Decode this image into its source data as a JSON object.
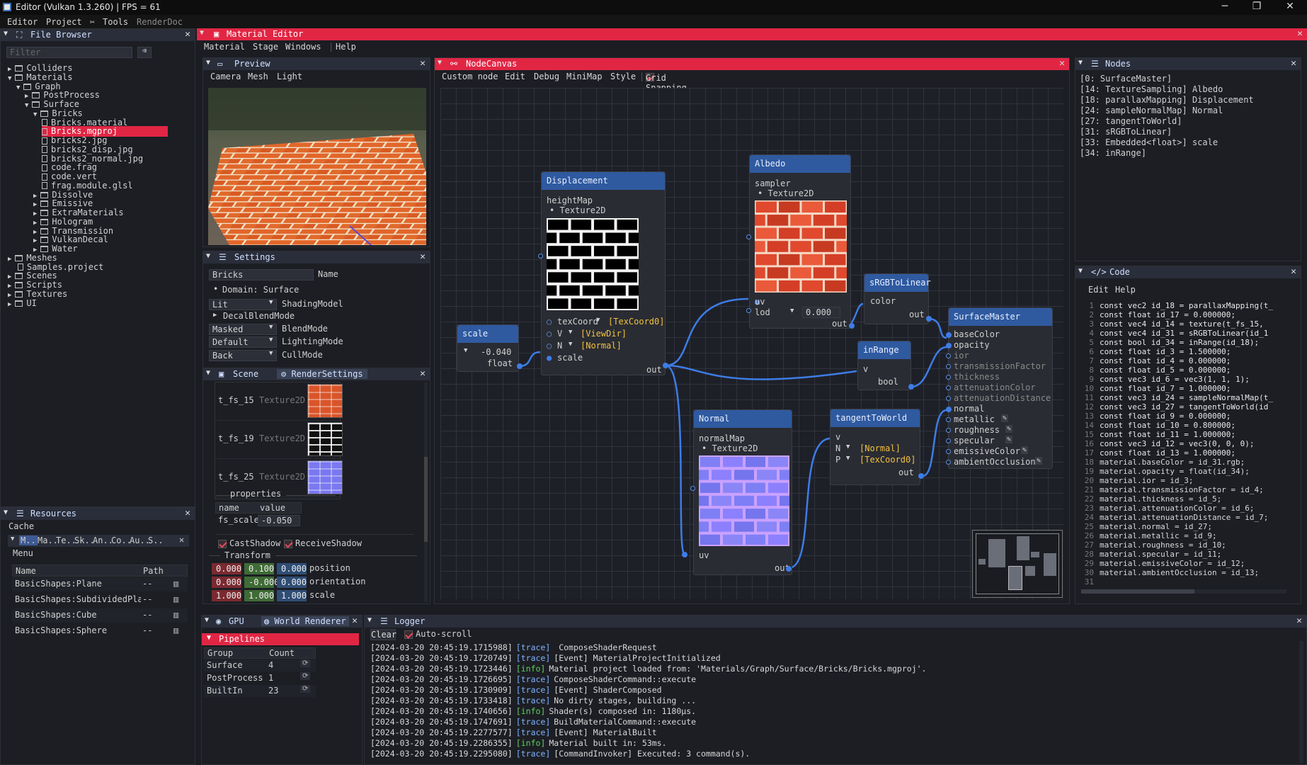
{
  "window": {
    "title": "Editor (Vulkan 1.3.260) | FPS = 61",
    "menu": [
      "Editor",
      "Project",
      "Tools",
      "RenderDoc"
    ]
  },
  "file_browser": {
    "title": "File Browser",
    "filter_placeholder": "Filter",
    "items": [
      {
        "label": "Colliders",
        "kind": "folder",
        "depth": 1,
        "open": false
      },
      {
        "label": "Materials",
        "kind": "folder",
        "depth": 1,
        "open": true
      },
      {
        "label": "Graph",
        "kind": "folder",
        "depth": 2,
        "open": true
      },
      {
        "label": "PostProcess",
        "kind": "folder",
        "depth": 3,
        "open": false
      },
      {
        "label": "Surface",
        "kind": "folder",
        "depth": 3,
        "open": true
      },
      {
        "label": "Bricks",
        "kind": "folder",
        "depth": 4,
        "open": true
      },
      {
        "label": "Bricks.material",
        "kind": "file",
        "depth": 5
      },
      {
        "label": "Bricks.mgproj",
        "kind": "file",
        "depth": 5,
        "selected": true
      },
      {
        "label": "bricks2.jpg",
        "kind": "file",
        "depth": 5
      },
      {
        "label": "bricks2_disp.jpg",
        "kind": "file",
        "depth": 5
      },
      {
        "label": "bricks2_normal.jpg",
        "kind": "file",
        "depth": 5
      },
      {
        "label": "code.frag",
        "kind": "file",
        "depth": 5
      },
      {
        "label": "code.vert",
        "kind": "file",
        "depth": 5
      },
      {
        "label": "frag.module.glsl",
        "kind": "file",
        "depth": 5
      },
      {
        "label": "Dissolve",
        "kind": "folder",
        "depth": 4,
        "open": false
      },
      {
        "label": "Emissive",
        "kind": "folder",
        "depth": 4,
        "open": false
      },
      {
        "label": "ExtraMaterials",
        "kind": "folder",
        "depth": 4,
        "open": false
      },
      {
        "label": "Hologram",
        "kind": "folder",
        "depth": 4,
        "open": false
      },
      {
        "label": "Transmission",
        "kind": "folder",
        "depth": 4,
        "open": false
      },
      {
        "label": "VulkanDecal",
        "kind": "folder",
        "depth": 4,
        "open": false
      },
      {
        "label": "Water",
        "kind": "folder",
        "depth": 4,
        "open": false
      },
      {
        "label": "Meshes",
        "kind": "folder",
        "depth": 1,
        "open": false
      },
      {
        "label": "Samples.project",
        "kind": "file",
        "depth": 1
      },
      {
        "label": "Scenes",
        "kind": "folder",
        "depth": 1,
        "open": false
      },
      {
        "label": "Scripts",
        "kind": "folder",
        "depth": 1,
        "open": false
      },
      {
        "label": "Textures",
        "kind": "folder",
        "depth": 1,
        "open": false
      },
      {
        "label": "UI",
        "kind": "folder",
        "depth": 1,
        "open": false
      }
    ]
  },
  "resources": {
    "title": "Resources",
    "cache": "Cache",
    "tabs": [
      "M..",
      "Ma..",
      "Te..",
      "Sk..",
      "An..",
      "Co..",
      "Au..",
      "S.."
    ],
    "menu": "Menu",
    "col_name": "Name",
    "col_path": "Path",
    "rows": [
      {
        "name": "BasicShapes:Plane",
        "path": "--"
      },
      {
        "name": "BasicShapes:SubdividedPla",
        "path": "--"
      },
      {
        "name": "BasicShapes:Cube",
        "path": "--"
      },
      {
        "name": "BasicShapes:Sphere",
        "path": "--"
      }
    ]
  },
  "material_editor": {
    "title": "Material Editor",
    "menu": [
      "Material",
      "Stage",
      "Windows",
      "Help"
    ]
  },
  "preview": {
    "title": "Preview",
    "menu": [
      "Camera",
      "Mesh",
      "Light"
    ]
  },
  "settings": {
    "title": "Settings",
    "name_value": "Bricks",
    "name_label": "Name",
    "domain": "Domain: Surface",
    "shading_value": "Lit",
    "shading_label": "ShadingModel",
    "decal_label": "DecalBlendMode",
    "blend_value": "Masked",
    "blend_label": "BlendMode",
    "lighting_value": "Default",
    "lighting_label": "LightingMode",
    "cull_value": "Back",
    "cull_label": "CullMode"
  },
  "scene": {
    "tab1": "Scene",
    "tab2": "RenderSettings",
    "textures": [
      {
        "name": "t_fs_15",
        "type": "Texture2D"
      },
      {
        "name": "t_fs_19",
        "type": "Texture2D"
      },
      {
        "name": "t_fs_25",
        "type": "Texture2D"
      }
    ],
    "properties_label": "properties",
    "col_name": "name",
    "col_value": "value",
    "prop_name": "fs_scale",
    "prop_value": "-0.050",
    "cast_shadow": "CastShadow",
    "receive_shadow": "ReceiveShadow",
    "transform_label": "Transform",
    "position": {
      "x": "0.000",
      "y": "0.100",
      "z": "0.000",
      "label": "position"
    },
    "orientation": {
      "x": "0.000",
      "y": "-0.000",
      "z": "0.000",
      "label": "orientation"
    },
    "scale": {
      "x": "1.000",
      "y": "1.000",
      "z": "1.000",
      "label": "scale"
    }
  },
  "gpu": {
    "tab1": "GPU",
    "tab2": "World Renderer",
    "pipelines": "Pipelines",
    "col_group": "Group",
    "col_count": "Count",
    "rows": [
      {
        "group": "Surface",
        "count": "4"
      },
      {
        "group": "PostProcess",
        "count": "1"
      },
      {
        "group": "BuiltIn",
        "count": "23"
      }
    ]
  },
  "canvas": {
    "title": "NodeCanvas",
    "menu": [
      "Custom node",
      "Edit",
      "Debug",
      "MiniMap",
      "Style"
    ],
    "grid_snapping": "Grid Snapping",
    "nodes": {
      "scale": {
        "title": "scale",
        "value": "-0.040",
        "out": "float"
      },
      "displacement": {
        "title": "Displacement",
        "heightmap": "heightMap",
        "tex": "Texture2D",
        "texcoord": "texCoord",
        "texcoord_v": "[TexCoord0]",
        "v": "V",
        "v_v": "[ViewDir]",
        "n": "N",
        "n_v": "[Normal]",
        "scale": "scale",
        "out": "out"
      },
      "albedo": {
        "title": "Albedo",
        "sampler": "sampler",
        "tex": "Texture2D",
        "uv": "uv",
        "lod": "lod",
        "lod_v": "0.000",
        "out": "out"
      },
      "srgb": {
        "title": "sRGBToLinear",
        "color": "color",
        "out": "out"
      },
      "inrange": {
        "title": "inRange",
        "v": "v",
        "out": "bool"
      },
      "normal": {
        "title": "Normal",
        "map": "normalMap",
        "tex": "Texture2D",
        "uv": "uv",
        "out": "out"
      },
      "tangent": {
        "title": "tangentToWorld",
        "v": "v",
        "n": "N",
        "n_v": "[Normal]",
        "p": "P",
        "p_v": "[TexCoord0]",
        "out": "out"
      },
      "master": {
        "title": "SurfaceMaster",
        "inputs": [
          "baseColor",
          "opacity",
          "ior",
          "transmissionFactor",
          "thickness",
          "attenuationColor",
          "attenuationDistance",
          "normal",
          "metallic",
          "roughness",
          "specular",
          "emissiveColor",
          "ambientOcclusion"
        ]
      }
    }
  },
  "nodes_panel": {
    "title": "Nodes",
    "items": [
      "[0: SurfaceMaster]",
      "[14: TextureSampling] Albedo",
      "[18: parallaxMapping] Displacement",
      "[24: sampleNormalMap] Normal",
      "[27: tangentToWorld]",
      "[31: sRGBToLinear]",
      "[33: Embedded<float>] scale",
      "[34: inRange]"
    ]
  },
  "code_panel": {
    "title": "Code",
    "menu": [
      "Edit",
      "Help"
    ],
    "lines": [
      "const vec2 id_18 = parallaxMapping(t_",
      "const float id_17 = 0.000000;",
      "const vec4 id_14 = texture(t_fs_15,",
      "const vec4 id_31 = sRGBToLinear(id_1",
      "const bool id_34 = inRange(id_18);",
      "const float id_3 = 1.500000;",
      "const float id_4 = 0.000000;",
      "const float id_5 = 0.000000;",
      "const vec3 id_6 = vec3(1, 1, 1);",
      "const float id_7 = 1.000000;",
      "const vec3 id_24 = sampleNormalMap(t_",
      "const vec3 id_27 = tangentToWorld(id",
      "const float id_9 = 0.000000;",
      "const float id_10 = 0.800000;",
      "const float id_11 = 1.000000;",
      "const vec3 id_12 = vec3(0, 0, 0);",
      "const float id_13 = 1.000000;",
      "material.baseColor = id_31.rgb;",
      "material.opacity = float(id_34);",
      "material.ior = id_3;",
      "material.transmissionFactor = id_4;",
      "material.thickness = id_5;",
      "material.attenuationColor = id_6;",
      "material.attenuationDistance = id_7;",
      "material.normal = id_27;",
      "material.metallic = id_9;",
      "material.roughness = id_10;",
      "material.specular = id_11;",
      "material.emissiveColor = id_12;",
      "material.ambientOcclusion = id_13;",
      ""
    ]
  },
  "logger": {
    "title": "Logger",
    "clear": "Clear",
    "autoscroll": "Auto-scroll",
    "lines": [
      {
        "ts": "[2024-03-20 20:45:19.1715988]",
        "tag": "[trace]",
        "msg": " ComposeShaderRequest"
      },
      {
        "ts": "[2024-03-20 20:45:19.1720749]",
        "tag": "[trace]",
        "msg": "[Event] MaterialProjectInitialized"
      },
      {
        "ts": "[2024-03-20 20:45:19.1723446]",
        "tag": "[info]",
        "msg": "Material project loaded from: 'Materials/Graph/Surface/Bricks/Bricks.mgproj'."
      },
      {
        "ts": "[2024-03-20 20:45:19.1726695]",
        "tag": "[trace]",
        "msg": "ComposeShaderCommand::execute"
      },
      {
        "ts": "[2024-03-20 20:45:19.1730909]",
        "tag": "[trace]",
        "msg": "[Event] ShaderComposed"
      },
      {
        "ts": "[2024-03-20 20:45:19.1733418]",
        "tag": "[trace]",
        "msg": "No dirty stages, building ..."
      },
      {
        "ts": "[2024-03-20 20:45:19.1740656]",
        "tag": "[info]",
        "msg": "Shader(s) composed in: 1180µs."
      },
      {
        "ts": "[2024-03-20 20:45:19.1747691]",
        "tag": "[trace]",
        "msg": "BuildMaterialCommand::execute"
      },
      {
        "ts": "[2024-03-20 20:45:19.2277577]",
        "tag": "[trace]",
        "msg": "[Event] MaterialBuilt"
      },
      {
        "ts": "[2024-03-20 20:45:19.2286355]",
        "tag": "[info]",
        "msg": "Material built in: 53ms."
      },
      {
        "ts": "[2024-03-20 20:45:19.2295080]",
        "tag": "[trace]",
        "msg": "[CommandInvoker] Executed: 3 command(s)."
      }
    ]
  }
}
